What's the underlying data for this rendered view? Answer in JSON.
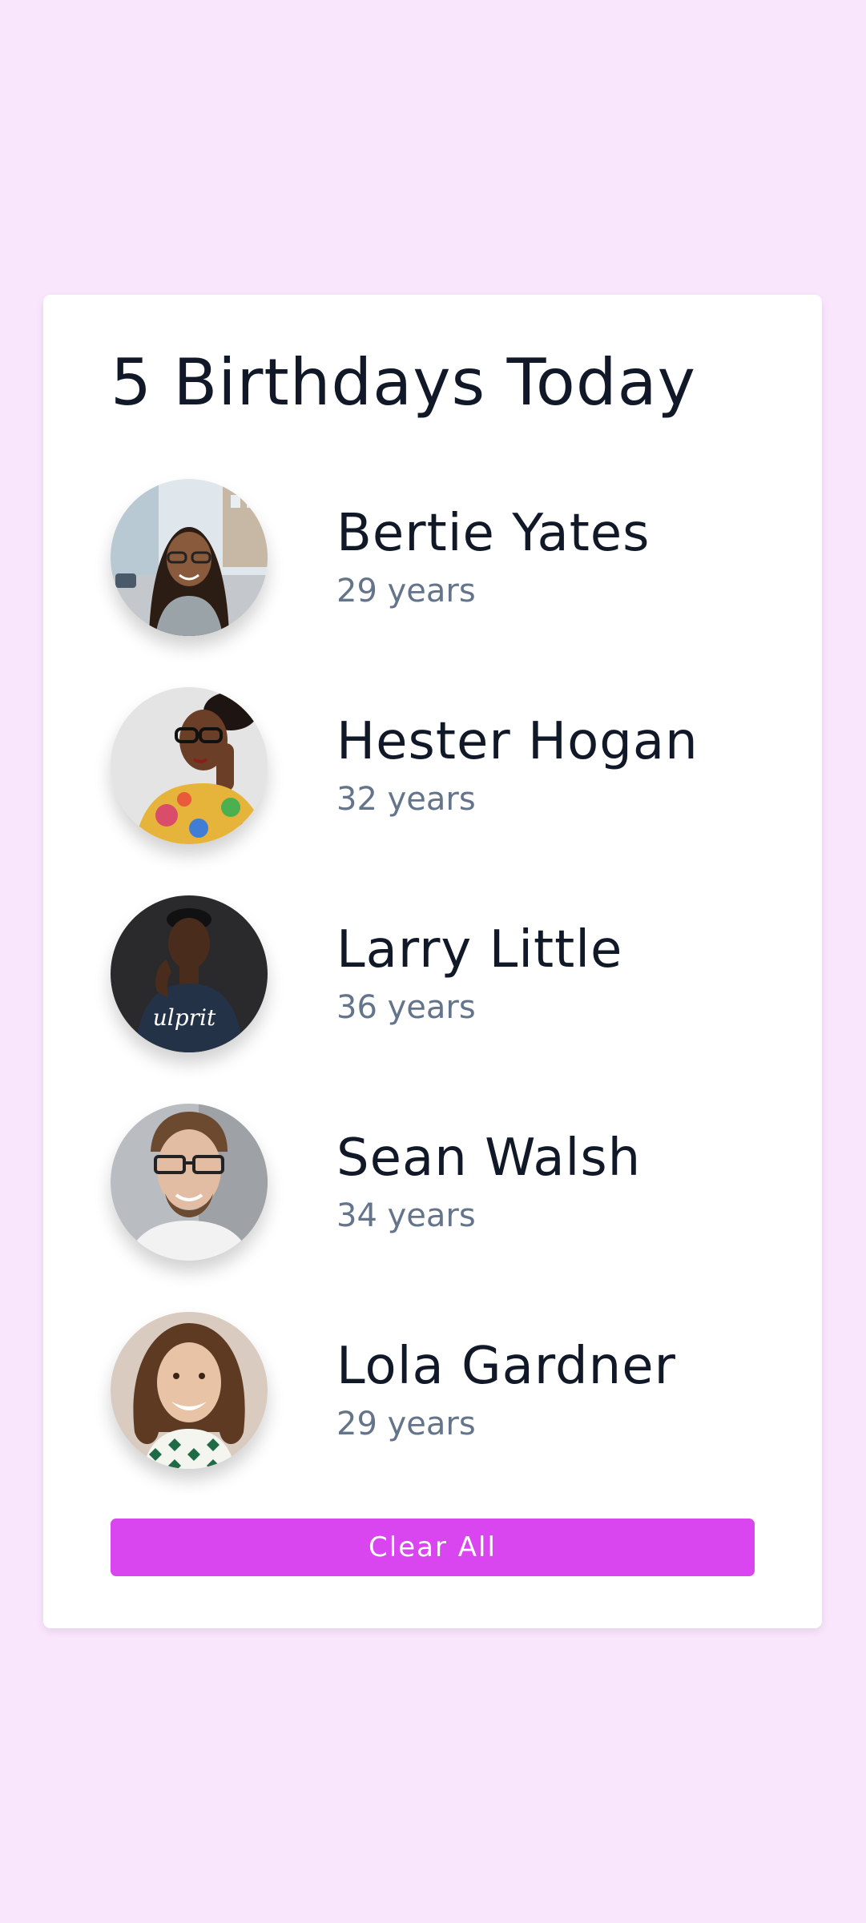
{
  "header": {
    "title": "5 Birthdays Today"
  },
  "people": [
    {
      "name": "Bertie Yates",
      "age": "29 years",
      "avatar": "woman-with-glasses-city-photo"
    },
    {
      "name": "Hester Hogan",
      "age": "32 years",
      "avatar": "woman-glasses-floral-top-photo"
    },
    {
      "name": "Larry Little",
      "age": "36 years",
      "avatar": "man-dark-tshirt-photo"
    },
    {
      "name": "Sean Walsh",
      "age": "34 years",
      "avatar": "man-glasses-smiling-photo"
    },
    {
      "name": "Lola Gardner",
      "age": "29 years",
      "avatar": "woman-curly-hair-smiling-photo"
    }
  ],
  "actions": {
    "clear_label": "Clear All"
  },
  "colors": {
    "background": "#f9e5fc",
    "card": "#ffffff",
    "accent": "#d946ef",
    "name_text": "#111827",
    "age_text": "#64748b"
  }
}
